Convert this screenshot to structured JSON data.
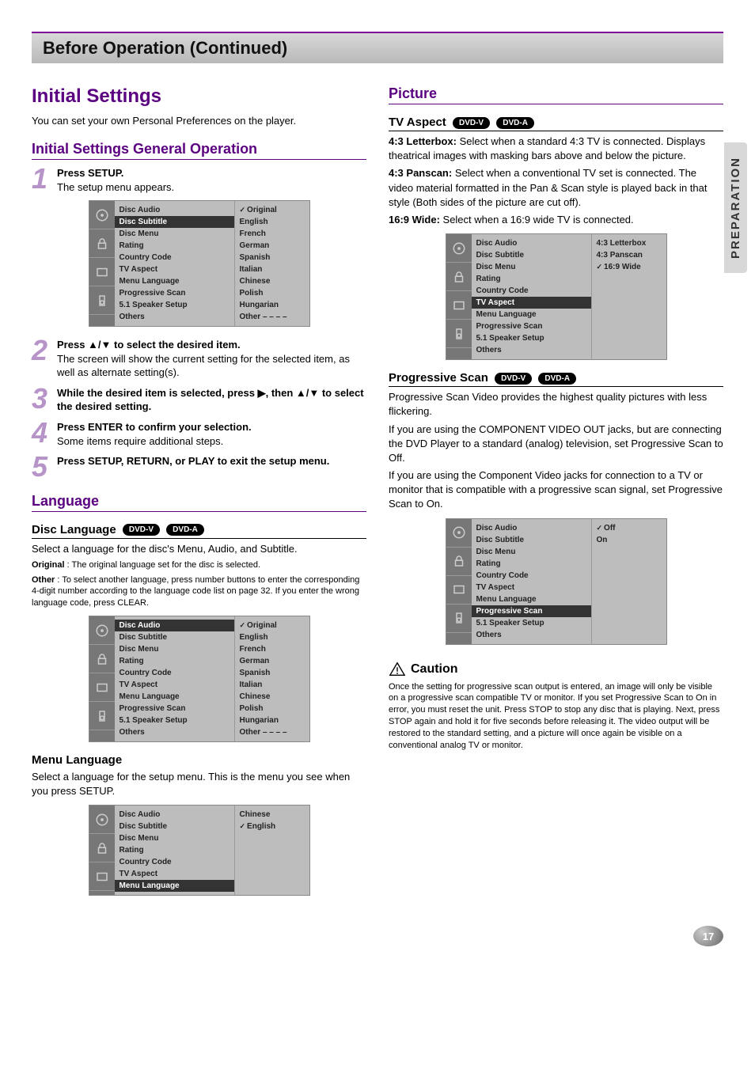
{
  "section_title": "Before Operation (Continued)",
  "side_tab": "PREPARATION",
  "page_number": "17",
  "left": {
    "h1": "Initial Settings",
    "intro": "You can set your own Personal Preferences on the player.",
    "h2_general": "Initial Settings General Operation",
    "steps": {
      "s1b": "Press SETUP.",
      "s1": "The setup menu appears.",
      "s2b": "Press ▲/▼ to select the desired item.",
      "s2": "The screen will show the current setting for the selected item, as well as alternate setting(s).",
      "s3b": "While the desired item is selected, press ▶, then ▲/▼ to select the desired setting.",
      "s4b": "Press ENTER to confirm your selection.",
      "s4": "Some items require additional steps.",
      "s5b": "Press SETUP, RETURN, or PLAY to exit the setup menu."
    },
    "h2_language": "Language",
    "disc_language_title": "Disc Language",
    "dvd_v": "DVD-V",
    "dvd_a": "DVD-A",
    "disc_language_intro": "Select a language for the disc's Menu, Audio, and Subtitle.",
    "original_b": "Original",
    "original_t": " : The original language set for the disc is selected.",
    "other_b": "Other",
    "other_t": " : To select another language, press number buttons to enter the corresponding 4-digit number according to the language code list on page 32. If you enter the wrong language code, press CLEAR.",
    "menu_language_title": "Menu Language",
    "menu_language_text": "Select a language for the setup menu. This is the menu you see when you press SETUP."
  },
  "right": {
    "h2_picture": "Picture",
    "tv_aspect_title": "TV Aspect",
    "lb_b": "4:3 Letterbox:",
    "lb_t": " Select when a standard 4:3 TV is connected. Displays theatrical images with masking bars above and below the picture.",
    "ps_b": "4:3 Panscan:",
    "ps_t": " Select when a conventional TV set is connected. The video material formatted in the Pan & Scan style is played back in that style (Both sides of the picture are cut off).",
    "wd_b": "16:9 Wide:",
    "wd_t": " Select when a 16:9 wide TV is connected.",
    "prog_title": "Progressive Scan",
    "prog_p1": "Progressive Scan Video provides the highest quality pictures with less flickering.",
    "prog_p2": "If you are using the COMPONENT VIDEO OUT jacks, but are connecting the DVD Player to a standard (analog) television, set Progressive Scan to Off.",
    "prog_p3": "If you are using the Component Video jacks for connection to a TV or monitor that is compatible with a progressive scan signal, set Progressive Scan to On.",
    "caution_title": "Caution",
    "caution_text": "Once the setting for progressive scan output is entered, an image will only be visible on a progressive scan compatible TV or monitor. If you set Progressive Scan to On in error, you must reset the unit. Press STOP to stop any disc that is playing. Next, press STOP again and hold it for five seconds before releasing it. The video output will be restored to the standard setting, and a picture will once again be visible on a conventional analog TV or monitor."
  },
  "menus": {
    "items": {
      "r0": "Disc Audio",
      "r1": "Disc Subtitle",
      "r2": "Disc Menu",
      "r3": "Rating",
      "r4": "Country Code",
      "r5": "TV Aspect",
      "r6": "Menu Language",
      "r7": "Progressive Scan",
      "r8": "5.1 Speaker Setup",
      "r9": "Others"
    },
    "langs": {
      "o0": "Original",
      "o1": "English",
      "o2": "French",
      "o3": "German",
      "o4": "Spanish",
      "o5": "Italian",
      "o6": "Chinese",
      "o7": "Polish",
      "o8": "Hungarian",
      "o9": "Other  – – – –"
    },
    "aspect": {
      "a0": "4:3   Letterbox",
      "a1": "4:3   Panscan",
      "a2": "16:9 Wide"
    },
    "menulang": {
      "m0": "Chinese",
      "m1": "English"
    },
    "progopts": {
      "p0": "Off",
      "p1": "On"
    }
  },
  "chart_data": {
    "type": "table",
    "title": "DVD Setup Menu — items and option lists shown",
    "setup_items": [
      "Disc Audio",
      "Disc Subtitle",
      "Disc Menu",
      "Rating",
      "Country Code",
      "TV Aspect",
      "Menu Language",
      "Progressive Scan",
      "5.1 Speaker Setup",
      "Others"
    ],
    "screenshots": [
      {
        "selected_item": "Disc Subtitle",
        "options": [
          "Original",
          "English",
          "French",
          "German",
          "Spanish",
          "Italian",
          "Chinese",
          "Polish",
          "Hungarian",
          "Other  – – – –"
        ],
        "checked": "Original"
      },
      {
        "selected_item": "Disc Audio",
        "options": [
          "Original",
          "English",
          "French",
          "German",
          "Spanish",
          "Italian",
          "Chinese",
          "Polish",
          "Hungarian",
          "Other  – – – –"
        ],
        "checked": "Original"
      },
      {
        "selected_item": "Menu Language",
        "options": [
          "Chinese",
          "English"
        ],
        "checked": "English"
      },
      {
        "selected_item": "TV Aspect",
        "options": [
          "4:3   Letterbox",
          "4:3   Panscan",
          "16:9 Wide"
        ],
        "checked": "16:9 Wide"
      },
      {
        "selected_item": "Progressive Scan",
        "options": [
          "Off",
          "On"
        ],
        "checked": "Off"
      }
    ]
  }
}
